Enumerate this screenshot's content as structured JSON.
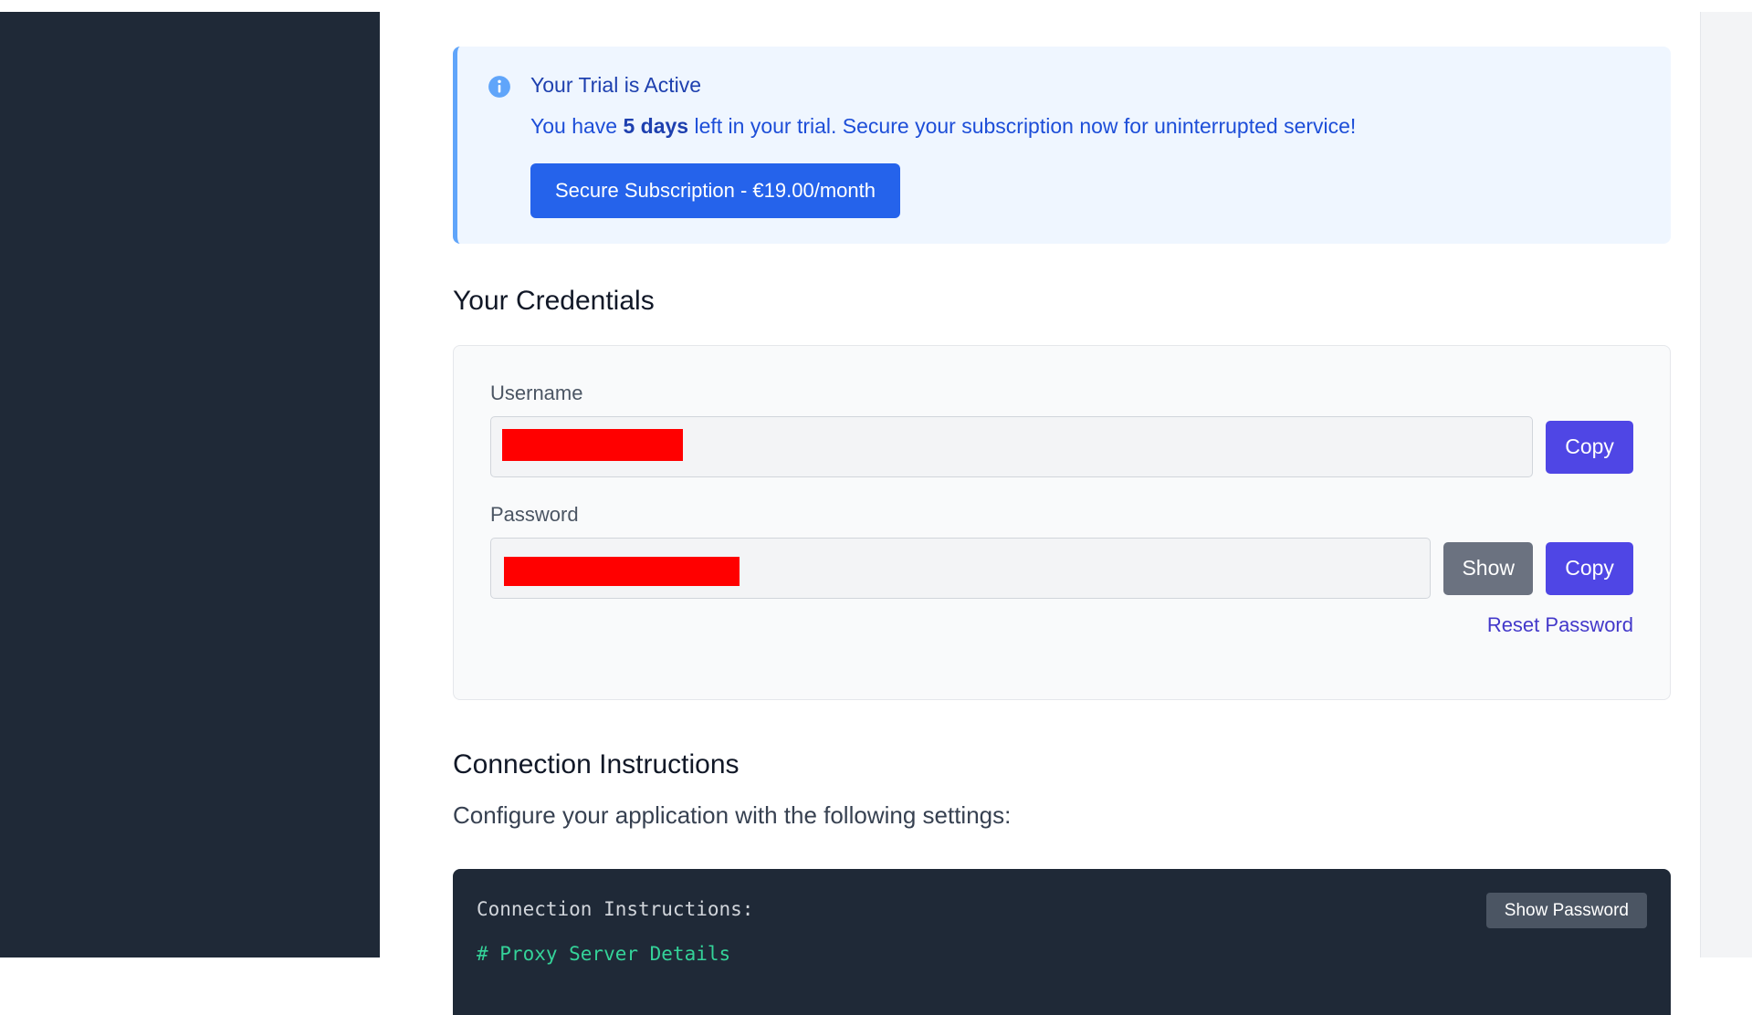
{
  "trial": {
    "title": "Your Trial is Active",
    "text_prefix": "You have ",
    "days": "5 days",
    "text_suffix": " left in your trial. Secure your subscription now for uninterrupted service!",
    "button_label": "Secure Subscription - €19.00/month"
  },
  "credentials": {
    "title": "Your Credentials",
    "username_label": "Username",
    "password_label": "Password",
    "copy_label": "Copy",
    "show_label": "Show",
    "reset_label": "Reset Password"
  },
  "connection": {
    "title": "Connection Instructions",
    "description": "Configure your application with the following settings:",
    "code_heading": "Connection Instructions:",
    "code_comment": "# Proxy Server Details",
    "show_password_label": "Show Password"
  },
  "colors": {
    "sidebar": "#1f2937",
    "primary": "#2563eb",
    "indigo": "#4f46e5",
    "redaction": "#ff0000"
  },
  "icons": {
    "trial_info": "info-icon"
  }
}
